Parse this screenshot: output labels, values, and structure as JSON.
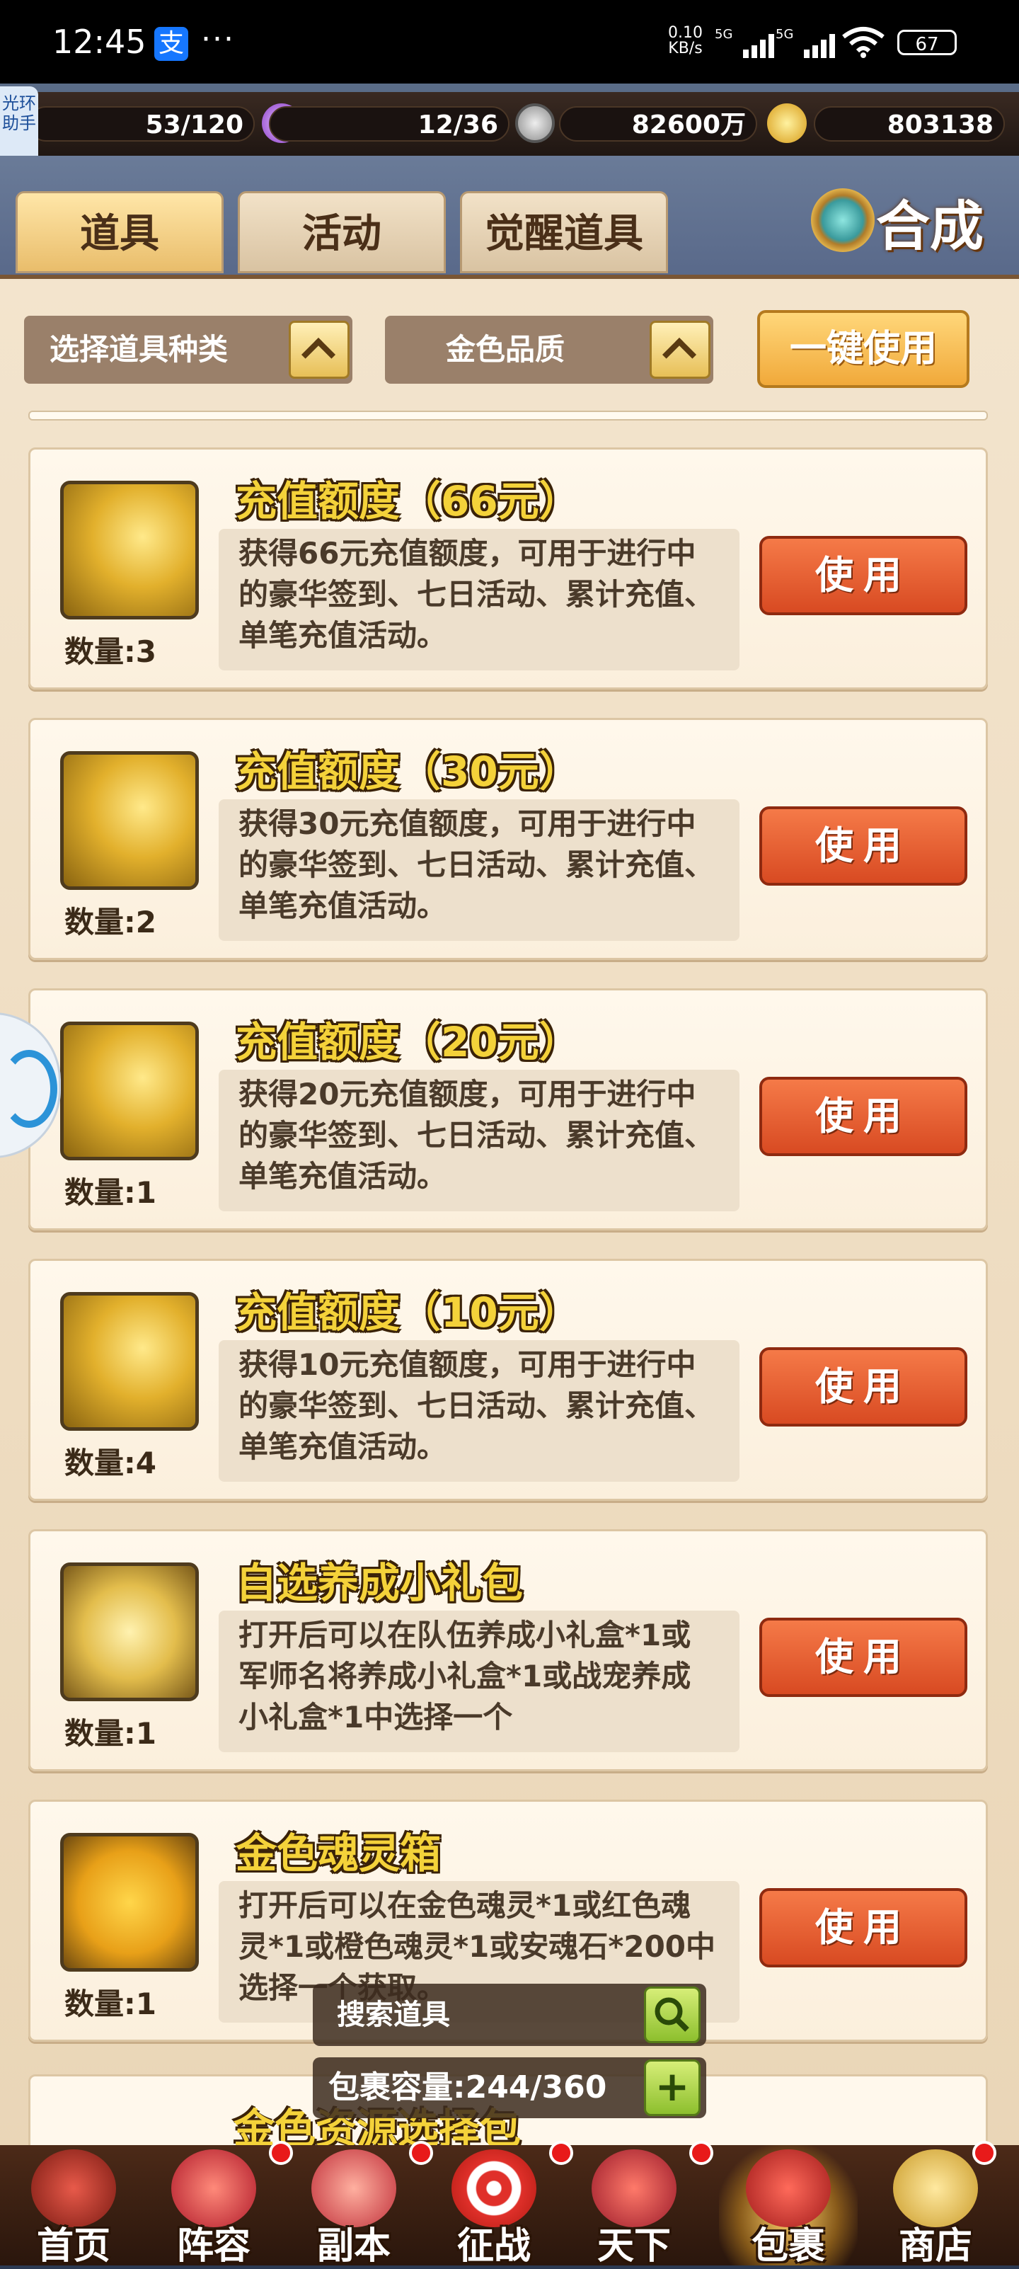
{
  "status_bar": {
    "time": "12:45",
    "app_icon": "支",
    "dots": "···",
    "net_speed": "0.10",
    "net_unit": "KB/s",
    "sig1": "5G",
    "sig2": "5G",
    "battery": "67"
  },
  "assistant": "光环助手",
  "resources": [
    {
      "name": "stamina",
      "value": "53/120"
    },
    {
      "name": "精力",
      "value": "12/36"
    },
    {
      "name": "coins",
      "value": "82600万"
    },
    {
      "name": "ingots",
      "value": "803138"
    }
  ],
  "tabs": [
    "道具",
    "活动",
    "觉醒道具"
  ],
  "compose_label": "合成",
  "filters": {
    "type_label": "选择道具种类",
    "quality_label": "金色品质",
    "one_key_label": "一键使用"
  },
  "items": [
    {
      "title": "充值额度（66元）",
      "desc": "获得66元充值额度，可用于进行中的豪华签到、七日活动、累计充值、单笔充值活动。",
      "qty": "数量:3",
      "icon": "gold-bars-coins-icon",
      "use": "使用"
    },
    {
      "title": "充值额度（30元）",
      "desc": "获得30元充值额度，可用于进行中的豪华签到、七日活动、累计充值、单笔充值活动。",
      "qty": "数量:2",
      "icon": "gold-bars-coins-icon",
      "use": "使用"
    },
    {
      "title": "充值额度（20元）",
      "desc": "获得20元充值额度，可用于进行中的豪华签到、七日活动、累计充值、单笔充值活动。",
      "qty": "数量:1",
      "icon": "gold-bars-coins-icon",
      "use": "使用"
    },
    {
      "title": "充值额度（10元）",
      "desc": "获得10元充值额度，可用于进行中的豪华签到、七日活动、累计充值、单笔充值活动。",
      "qty": "数量:4",
      "icon": "gold-bars-coins-icon",
      "use": "使用"
    },
    {
      "title": "自选养成小礼包",
      "desc": "打开后可以在队伍养成小礼盒*1或军师名将养成小礼盒*1或战宠养成小礼盒*1中选择一个",
      "qty": "数量:1",
      "icon": "treasure-chest-icon",
      "use": "使用"
    },
    {
      "title": "金色魂灵箱",
      "desc": "打开后可以在金色魂灵*1或红色魂灵*1或橙色魂灵*1或安魂石*200中选择一个获取。",
      "qty": "数量:1",
      "icon": "golden-gift-box-icon",
      "use": "使用"
    }
  ],
  "peek_title": "金色资源选择包",
  "search_placeholder": "搜索道具",
  "capacity": "包裹容量:244/360",
  "nav": [
    {
      "label": "首页",
      "dot": false
    },
    {
      "label": "阵容",
      "dot": true
    },
    {
      "label": "副本",
      "dot": true
    },
    {
      "label": "征战",
      "dot": true
    },
    {
      "label": "天下",
      "dot": true
    },
    {
      "label": "包裹",
      "dot": false,
      "active": true
    },
    {
      "label": "商店",
      "dot": true
    }
  ],
  "colors": {
    "title_gold": "#f4d23a",
    "use_button": "#e05a2c",
    "panel": "#f3e4cd"
  }
}
